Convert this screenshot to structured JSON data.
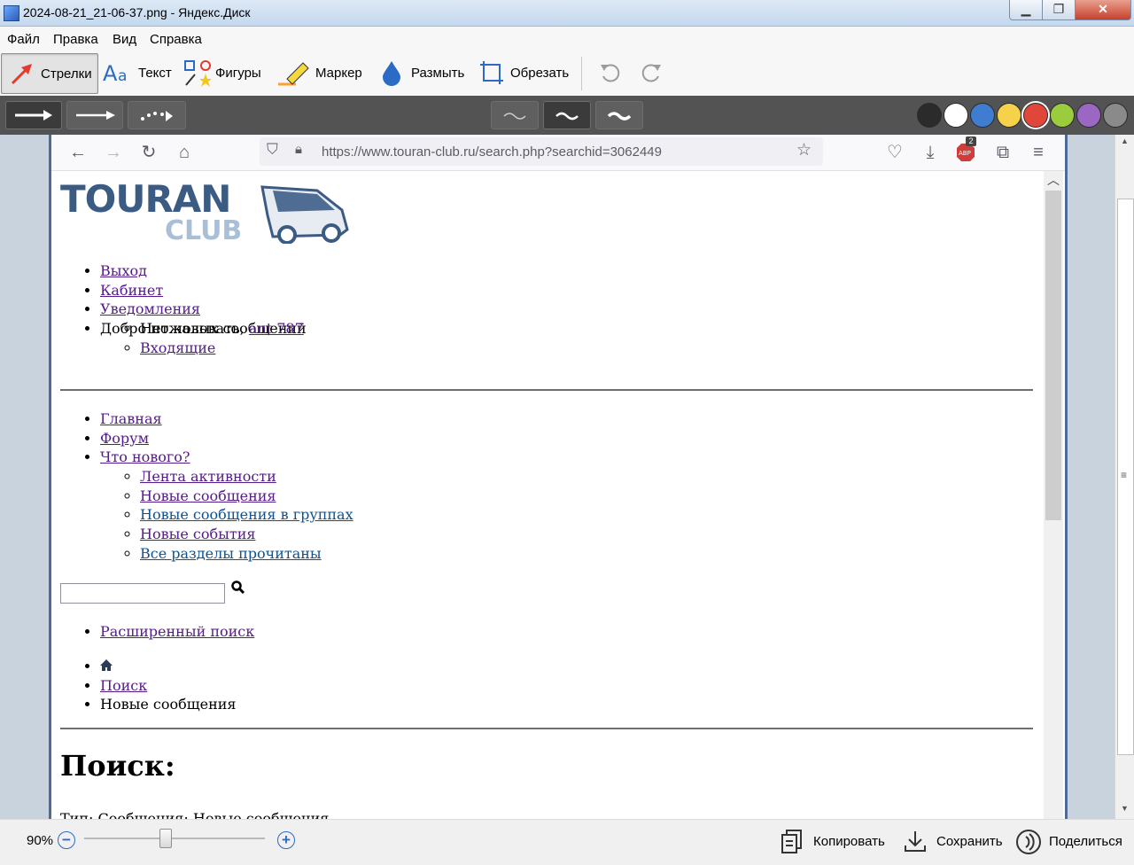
{
  "window": {
    "title": "2024-08-21_21-06-37.png - Яндекс.Диск",
    "min_glyph": "▁",
    "max_glyph": "❐",
    "close_glyph": "✕"
  },
  "menu": [
    "Файл",
    "Правка",
    "Вид",
    "Справка"
  ],
  "tools": {
    "arrows": "Стрелки",
    "text": "Текст",
    "shapes": "Фигуры",
    "marker": "Маркер",
    "blur": "Размыть",
    "crop": "Обрезать"
  },
  "palette": [
    "#2b2b2b",
    "#ffffff",
    "#3f7dd1",
    "#f5d24a",
    "#e0473a",
    "#9acc3d",
    "#9a67c3",
    "#8a8a8a"
  ],
  "browser": {
    "url": "https://www.touran-club.ru/search.php?searchid=3062449",
    "addon_badge": "2"
  },
  "logo": {
    "top": "TOURAN",
    "bottom": "CLUB"
  },
  "user_nav": {
    "logout": "Выход",
    "cabinet": "Кабинет",
    "notifications": "Уведомления",
    "no_new": "Нет новых сообщений",
    "inbox": "Входящие",
    "welcome": "Добро пожаловать,",
    "username": "ant 787"
  },
  "main_nav": {
    "home": "Главная",
    "forum": "Форум",
    "whats_new": "Что нового?",
    "activity": "Лента активности",
    "new_posts": "Новые сообщения",
    "new_posts_groups": "Новые сообщения в группах",
    "new_events": "Новые события",
    "all_read": "Все разделы прочитаны"
  },
  "search": {
    "value": "",
    "advanced": "Расширенный поиск"
  },
  "breadcrumb": {
    "search": "Поиск",
    "current": "Новые сообщения"
  },
  "page": {
    "heading": "Поиск:",
    "cut_text": "Тип: Сообщения; Новые сообщения"
  },
  "bottom": {
    "zoom": "90%",
    "zoom_level": 0.45,
    "minus": "−",
    "plus": "+",
    "copy": "Копировать",
    "save": "Сохранить",
    "share": "Поделиться"
  }
}
